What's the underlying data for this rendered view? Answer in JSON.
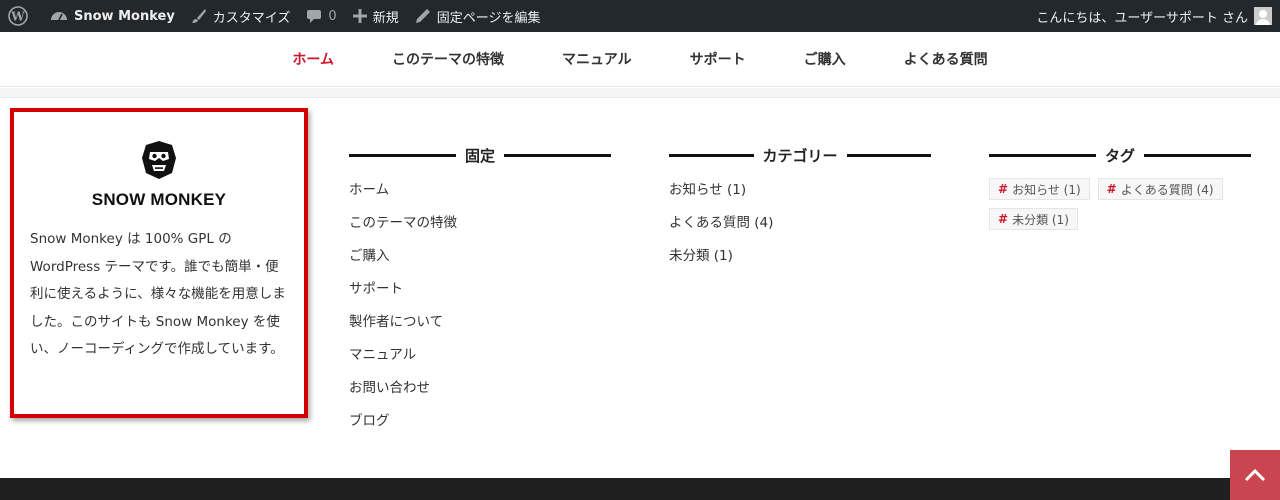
{
  "admin_bar": {
    "site_name": "Snow Monkey",
    "customize": "カスタマイズ",
    "comments_count": "0",
    "new": "新規",
    "edit_page": "固定ページを編集",
    "greeting": "こんにちは、ユーザーサポート さん"
  },
  "nav": {
    "items": [
      {
        "label": "ホーム"
      },
      {
        "label": "このテーマの特徴"
      },
      {
        "label": "マニュアル"
      },
      {
        "label": "サポート"
      },
      {
        "label": "ご購入"
      },
      {
        "label": "よくある質問"
      }
    ]
  },
  "profile": {
    "brand": "SNOW MONKEY",
    "description": "Snow Monkey は 100% GPL の WordPress テーマです。誰でも簡単・便利に使えるように、様々な機能を用意しました。このサイトも Snow Monkey を使い、ノーコーディングで作成しています。"
  },
  "widgets": {
    "pages": {
      "title": "固定",
      "items": [
        "ホーム",
        "このテーマの特徴",
        "ご購入",
        "サポート",
        "製作者について",
        "マニュアル",
        "お問い合わせ",
        "ブログ"
      ]
    },
    "categories": {
      "title": "カテゴリー",
      "items": [
        "お知らせ (1)",
        "よくある質問 (4)",
        "未分類 (1)"
      ]
    },
    "tags": {
      "title": "タグ",
      "hash": "#",
      "items": [
        "お知らせ (1)",
        "よくある質問 (4)",
        "未分類 (1)"
      ]
    }
  },
  "colors": {
    "accent": "#cd162c",
    "admin_bar_bg": "#23282d",
    "highlight_border": "#d40000",
    "page_top_bg": "#c9454f"
  },
  "icons": {
    "admin_bar": [
      "wordpress-logo-icon",
      "dashboard-icon",
      "brush-icon",
      "comment-icon",
      "plus-icon",
      "pencil-icon",
      "avatar"
    ],
    "page_top": "chevron-up-icon"
  }
}
